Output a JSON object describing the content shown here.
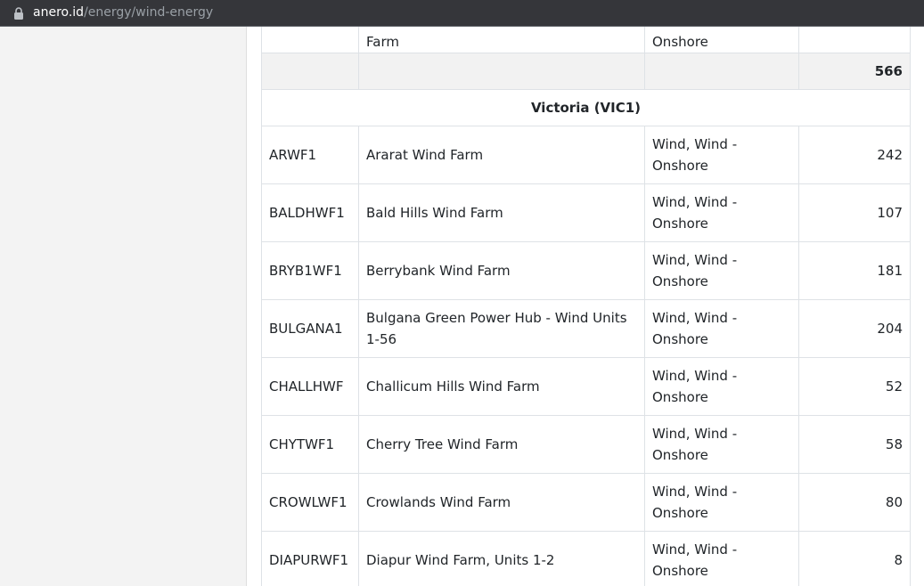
{
  "browser": {
    "url_host": "anero.id",
    "url_path": "/energy/wind-energy"
  },
  "table": {
    "partial_row": {
      "name": "Farm",
      "type": "Onshore"
    },
    "subtotal": {
      "capacity": "566"
    },
    "region_heading": "Victoria (VIC1)",
    "rows": [
      {
        "duid": "ARWF1",
        "name": "Ararat Wind Farm",
        "type": "Wind, Wind - Onshore",
        "capacity": "242"
      },
      {
        "duid": "BALDHWF1",
        "name": "Bald Hills Wind Farm",
        "type": "Wind, Wind - Onshore",
        "capacity": "107"
      },
      {
        "duid": "BRYB1WF1",
        "name": "Berrybank Wind Farm",
        "type": "Wind, Wind - Onshore",
        "capacity": "181"
      },
      {
        "duid": "BULGANA1",
        "name": "Bulgana Green Power Hub - Wind Units 1-56",
        "type": "Wind, Wind - Onshore",
        "capacity": "204"
      },
      {
        "duid": "CHALLHWF",
        "name": "Challicum Hills Wind Farm",
        "type": "Wind, Wind - Onshore",
        "capacity": "52"
      },
      {
        "duid": "CHYTWF1",
        "name": "Cherry Tree Wind Farm",
        "type": "Wind, Wind - Onshore",
        "capacity": "58"
      },
      {
        "duid": "CROWLWF1",
        "name": "Crowlands Wind Farm",
        "type": "Wind, Wind - Onshore",
        "capacity": "80"
      },
      {
        "duid": "DIAPURWF1",
        "name": "Diapur Wind Farm, Units 1-2",
        "type": "Wind, Wind - Onshore",
        "capacity": "8"
      }
    ]
  }
}
